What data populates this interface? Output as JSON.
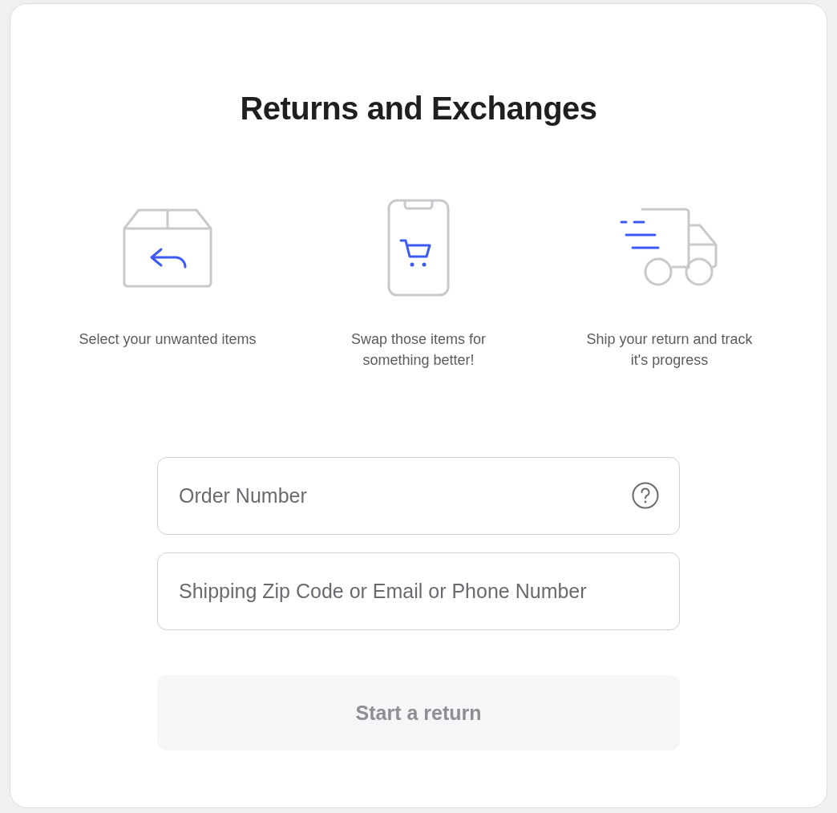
{
  "title": "Returns and Exchanges",
  "steps": [
    {
      "kind": "box-return",
      "caption": [
        "Select your unwanted items"
      ]
    },
    {
      "kind": "phone-cart",
      "caption": [
        "Swap those items for",
        "something better!"
      ]
    },
    {
      "kind": "truck",
      "caption": [
        "Ship your return and track",
        "it's progress"
      ]
    }
  ],
  "fields": [
    {
      "kind": "help",
      "placeholder": "Order Number"
    },
    {
      "kind": "plain",
      "placeholder": "Shipping Zip Code or Email or Phone Number"
    }
  ],
  "submit": {
    "label": "Start a return",
    "disabled": true
  }
}
